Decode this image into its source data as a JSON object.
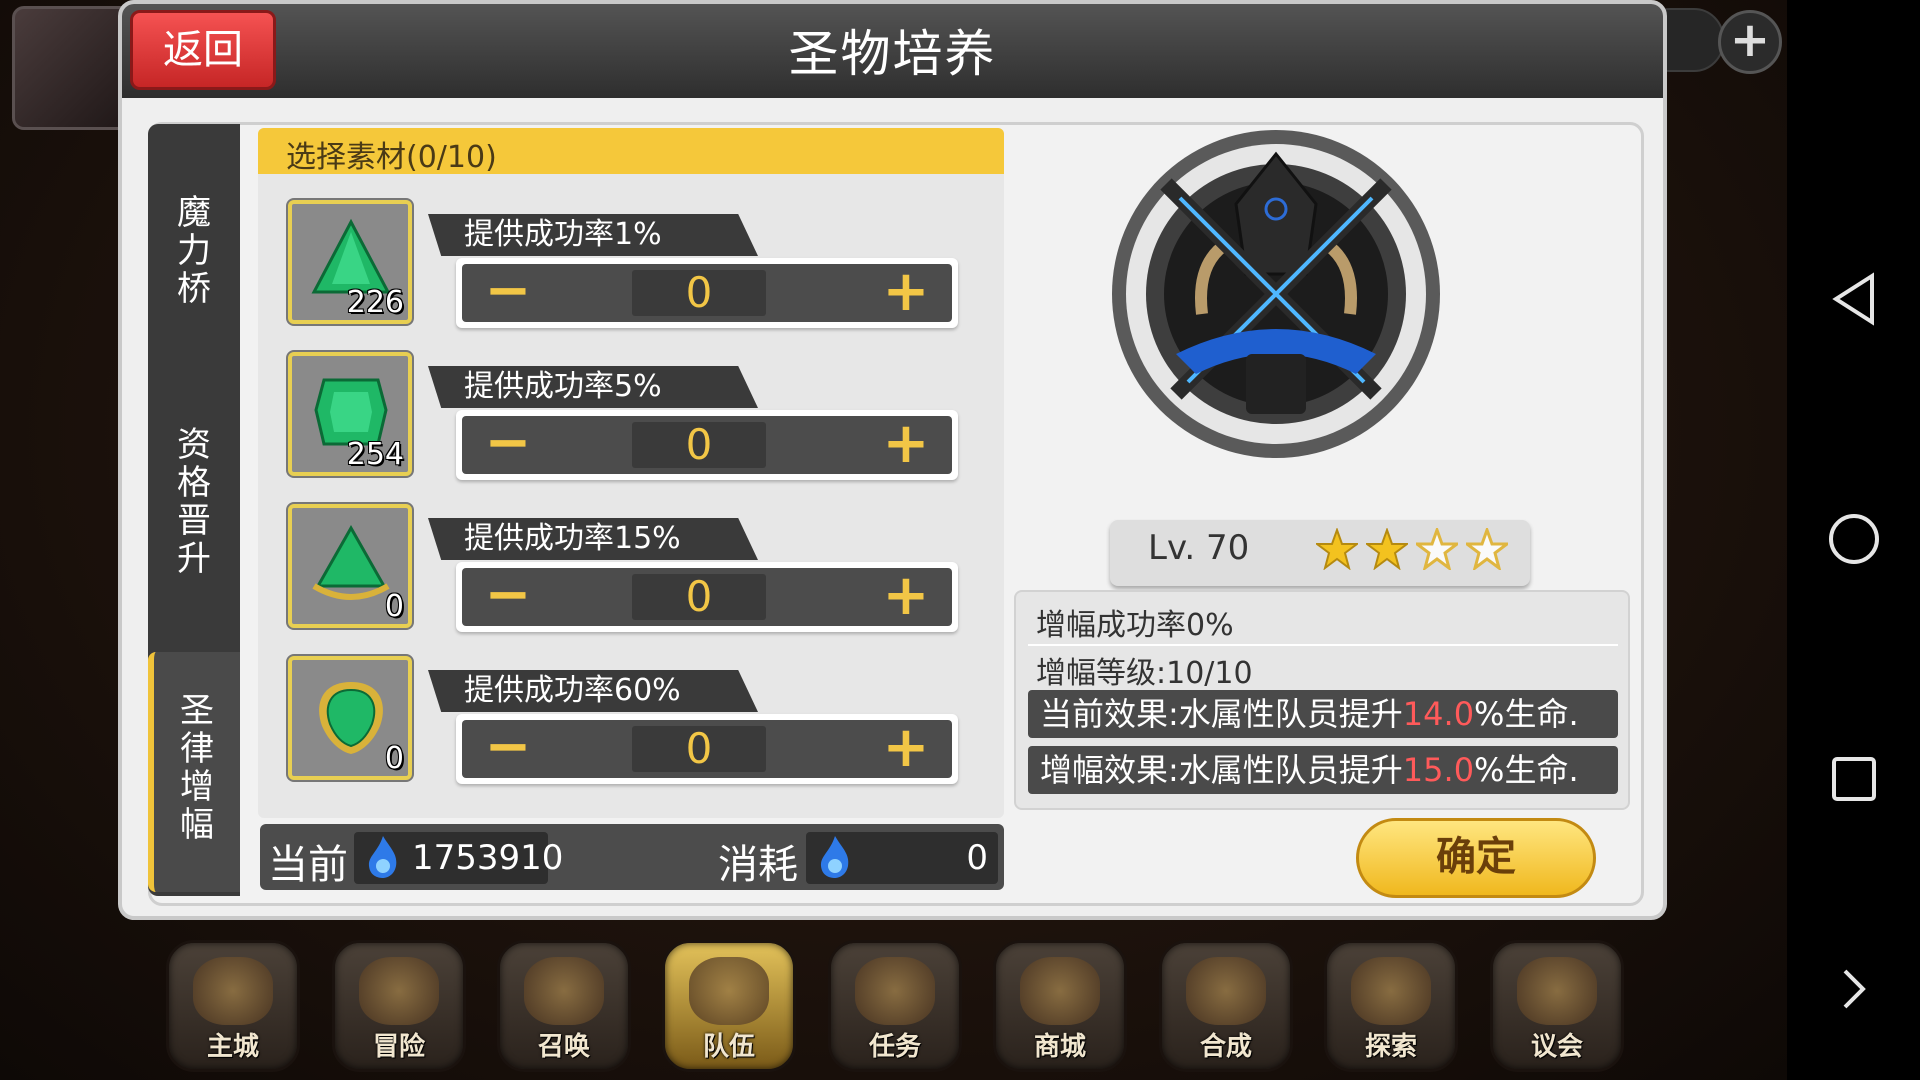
{
  "dialog": {
    "title": "圣物培养",
    "back_label": "返回",
    "confirm_label": "确定"
  },
  "side_tabs": [
    {
      "label": "魔力桥",
      "active": false
    },
    {
      "label": "资格晋升",
      "active": false
    },
    {
      "label": "圣律增幅",
      "active": true
    }
  ],
  "materials": {
    "header": "选择素材(0/10)",
    "items": [
      {
        "gem_icon": "green-triangle-gem",
        "count": "226",
        "rate_label": "提供成功率1%",
        "quantity": "0",
        "minus": "−",
        "plus": "+"
      },
      {
        "gem_icon": "green-square-gem",
        "count": "254",
        "rate_label": "提供成功率5%",
        "quantity": "0",
        "minus": "−",
        "plus": "+"
      },
      {
        "gem_icon": "green-crowned-gem",
        "count": "0",
        "rate_label": "提供成功率15%",
        "quantity": "0",
        "minus": "−",
        "plus": "+"
      },
      {
        "gem_icon": "green-gold-framed-gem",
        "count": "0",
        "rate_label": "提供成功率60%",
        "quantity": "0",
        "minus": "−",
        "plus": "+"
      }
    ]
  },
  "cost": {
    "current_label": "当前",
    "current_value": "1753910",
    "consume_label": "消耗",
    "consume_value": "0",
    "currency_icon": "blue-flame-icon"
  },
  "relic": {
    "level_text": "Lv. 70",
    "stars_filled": 2,
    "stars_total": 4,
    "emblem_icon": "crossed-swords-helm-emblem"
  },
  "info": {
    "success_rate": "增幅成功率0%",
    "amp_level": "增幅等级:10/10",
    "current_effect_prefix": "当前效果:水属性队员提升",
    "current_effect_value": "14.0",
    "current_effect_suffix": "%生命.",
    "amp_effect_prefix": "增幅效果:水属性队员提升",
    "amp_effect_value": "15.0",
    "amp_effect_suffix": "%生命."
  },
  "bottom_menu": [
    {
      "label": "主城",
      "icon": "crown-castle-icon",
      "active": false
    },
    {
      "label": "冒险",
      "icon": "crossed-weapons-icon",
      "active": false
    },
    {
      "label": "召唤",
      "icon": "summon-card-icon",
      "active": false
    },
    {
      "label": "队伍",
      "icon": "winged-crest-icon",
      "active": true
    },
    {
      "label": "任务",
      "icon": "quest-book-icon",
      "active": false
    },
    {
      "label": "商城",
      "icon": "shop-tree-icon",
      "active": false
    },
    {
      "label": "合成",
      "icon": "potion-flask-icon",
      "active": false
    },
    {
      "label": "探索",
      "icon": "explore-shovel-icon",
      "active": false
    },
    {
      "label": "议会",
      "icon": "council-crown-icon",
      "active": false
    }
  ],
  "system_nav": [
    "back-triangle-icon",
    "home-circle-icon",
    "recents-square-icon",
    "expand-chevron-icon"
  ],
  "colors": {
    "accent_yellow": "#f5c83a",
    "back_red": "#e53b3b",
    "effect_value_red": "#ff5a5a"
  }
}
